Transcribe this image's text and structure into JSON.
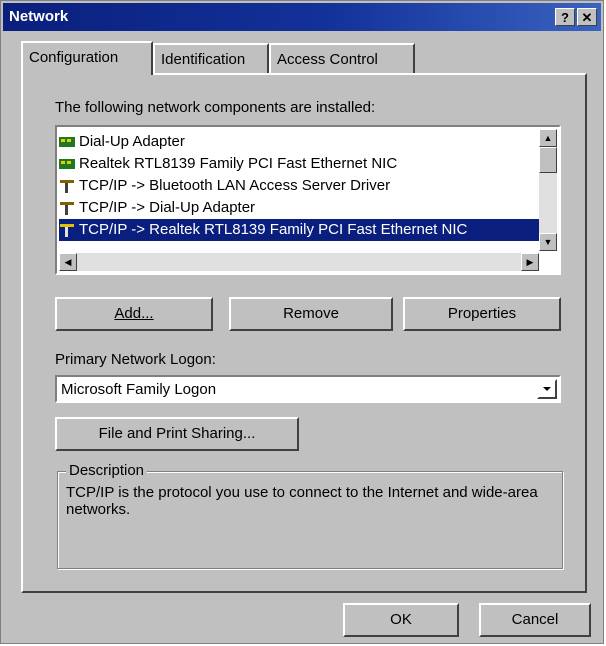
{
  "window": {
    "title": "Network",
    "help_label": "?",
    "close_label": "✕"
  },
  "tabs": [
    {
      "label": "Configuration",
      "active": true
    },
    {
      "label": "Identification",
      "active": false
    },
    {
      "label": "Access Control",
      "active": false
    }
  ],
  "components": {
    "heading": "The following network components are installed:",
    "items": [
      {
        "label": "Dial-Up Adapter",
        "icon": "network-adapter-icon",
        "selected": false
      },
      {
        "label": "Realtek RTL8139 Family PCI Fast Ethernet NIC",
        "icon": "network-adapter-icon",
        "selected": false
      },
      {
        "label": "TCP/IP -> Bluetooth LAN Access Server Driver",
        "icon": "protocol-icon",
        "selected": false
      },
      {
        "label": "TCP/IP -> Dial-Up Adapter",
        "icon": "protocol-icon",
        "selected": false
      },
      {
        "label": "TCP/IP -> Realtek RTL8139 Family PCI Fast Ethernet NIC",
        "icon": "protocol-icon",
        "selected": true
      }
    ]
  },
  "buttons": {
    "add": "Add...",
    "remove": "Remove",
    "properties": "Properties"
  },
  "logon": {
    "label": "Primary Network Logon:",
    "value": "Microsoft Family Logon"
  },
  "file_print": {
    "label": "File and Print Sharing..."
  },
  "description": {
    "legend": "Description",
    "text": "TCP/IP is the protocol you use to connect to the Internet and wide-area networks."
  },
  "footer": {
    "ok": "OK",
    "cancel": "Cancel"
  },
  "colors": {
    "face": "#c0c0c0",
    "title_bar": "#0a1f7d",
    "selection": "#0a1f7d"
  }
}
